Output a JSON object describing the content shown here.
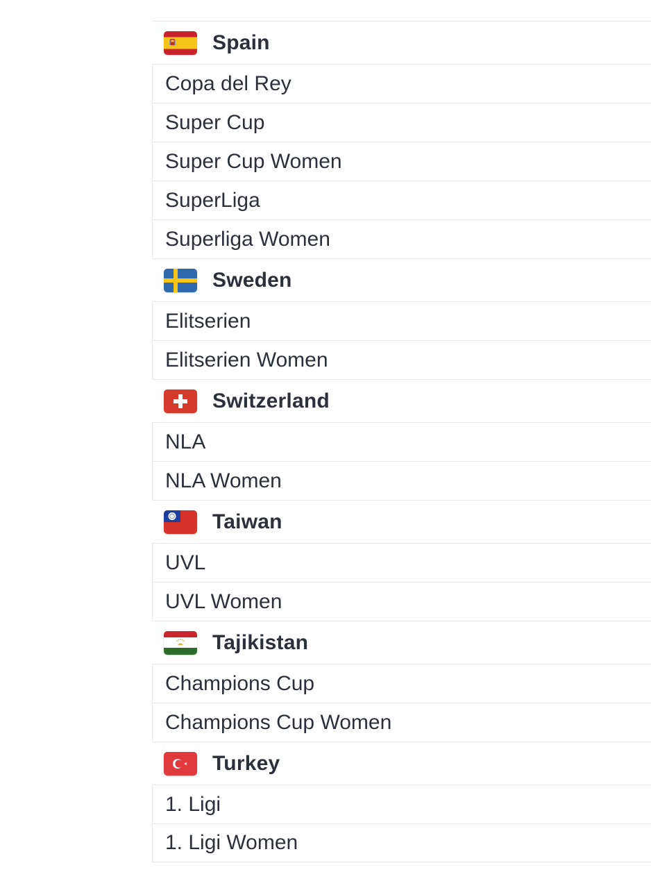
{
  "groups": [
    {
      "country": "Spain",
      "flag_icon": "spain-flag-icon",
      "leagues": [
        "Copa del Rey",
        "Super Cup",
        "Super Cup Women",
        "SuperLiga",
        "Superliga Women"
      ]
    },
    {
      "country": "Sweden",
      "flag_icon": "sweden-flag-icon",
      "leagues": [
        "Elitserien",
        "Elitserien Women"
      ]
    },
    {
      "country": "Switzerland",
      "flag_icon": "switzerland-flag-icon",
      "leagues": [
        "NLA",
        "NLA Women"
      ]
    },
    {
      "country": "Taiwan",
      "flag_icon": "taiwan-flag-icon",
      "leagues": [
        "UVL",
        "UVL Women"
      ]
    },
    {
      "country": "Tajikistan",
      "flag_icon": "tajikistan-flag-icon",
      "leagues": [
        "Champions Cup",
        "Champions Cup Women"
      ]
    },
    {
      "country": "Turkey",
      "flag_icon": "turkey-flag-icon",
      "leagues": [
        "1. Ligi",
        "1. Ligi Women"
      ]
    }
  ],
  "colors": {
    "text": "#2b303b",
    "divider": "#e7e9ec"
  }
}
